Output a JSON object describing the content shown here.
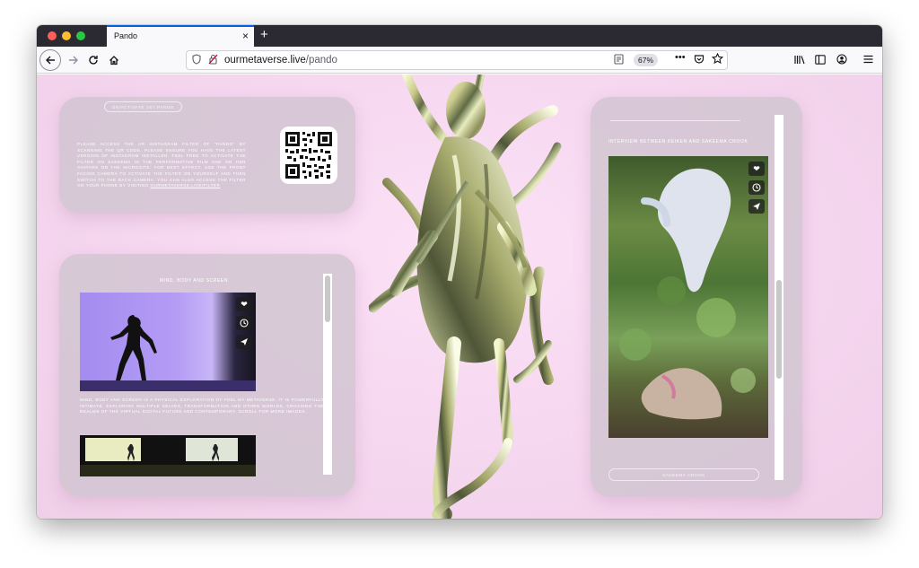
{
  "browser": {
    "tab_title": "Pando",
    "tab_close": "×",
    "new_tab": "+",
    "url_domain": "ourmetaverse.live",
    "url_path": "/pando",
    "zoom": "67%"
  },
  "left_top_card": {
    "button_label": "De/activate 1st Pando",
    "instructions": "Please access the AR Instagram filter of \"Pando\" by scanning the QR code. Please ensure you have the latest version of Instagram installed. Feel free to activate the filter on Sakeema in the performative film and on her avatars on the microsite. For best effect, use the front facing camera to activate the filter on yourself and then switch to the back camera. You can also access the filter on your phone by visiting",
    "link_text": "ourmetaverse.live/filter"
  },
  "left_bottom_card": {
    "heading": "Mind, Body and Screen",
    "description": "Mind, Body and Screen is a physical exploration of Feel My Metaverse. It is powerfully intimate, exploring multiple selves, transformation and other worlds, crossing the realms of the virtual digital future and contemporary. Scroll for more images."
  },
  "right_card": {
    "heading": "Interview between Keiken and Sakeema Crook",
    "button_label": "Sakeema Crook"
  },
  "colors": {
    "background": "#f5d6ef",
    "card": "#d1c4d1",
    "video_purple": "#a48cf0"
  }
}
